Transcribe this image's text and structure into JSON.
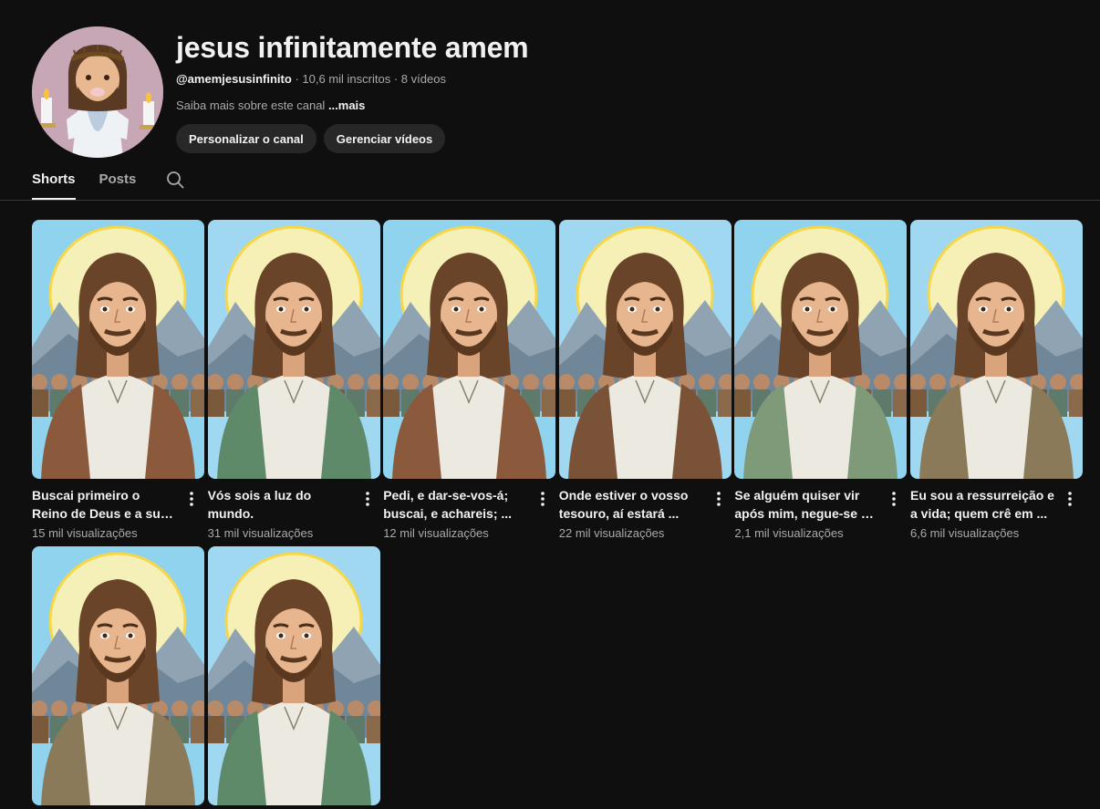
{
  "channel": {
    "title": "jesus infinitamente amem",
    "handle": "@amemjesusinfinito",
    "subscribers": "10,6 mil inscritos",
    "videos": "8 vídeos",
    "about": "Saiba mais sobre este canal",
    "more": "...mais",
    "avatar_icon": "jesus-cartoon-avatar"
  },
  "buttons": {
    "customize": "Personalizar o canal",
    "manage": "Gerenciar vídeos"
  },
  "tabs": [
    {
      "label": "Shorts",
      "active": true
    },
    {
      "label": "Posts",
      "active": false
    }
  ],
  "search_icon": "search-icon",
  "shorts": [
    {
      "title": "Buscai primeiro o Reino de Deus e a sua justiç...",
      "views": "15 mil visualizações",
      "robe": "#8b5a3c",
      "sky": "#8fd3ee"
    },
    {
      "title": "Vós sois a luz do mundo.",
      "views": "31 mil visualizações",
      "robe": "#5e8a6a",
      "sky": "#9fd8f0"
    },
    {
      "title": "Pedi, e dar-se-vos-á; buscai, e achareis; ...",
      "views": "12 mil visualizações",
      "robe": "#8b5a3c",
      "sky": "#8fd3ee"
    },
    {
      "title": "Onde estiver o vosso tesouro, aí estará ...",
      "views": "22 mil visualizações",
      "robe": "#7a5238",
      "sky": "#9fd8f0"
    },
    {
      "title": "Se alguém quiser vir após mim, negue-se a ...",
      "views": "2,1 mil visualizações",
      "robe": "#7f9a78",
      "sky": "#8fd3ee"
    },
    {
      "title": "Eu sou a ressurreição e a vida; quem crê em ...",
      "views": "6,6 mil visualizações",
      "robe": "#8a7a5a",
      "sky": "#9fd8f0"
    },
    {
      "title": "",
      "views": "",
      "robe": "#8a7a5a",
      "sky": "#8fd3ee"
    },
    {
      "title": "",
      "views": "",
      "robe": "#5e8a6a",
      "sky": "#9fd8f0"
    }
  ]
}
